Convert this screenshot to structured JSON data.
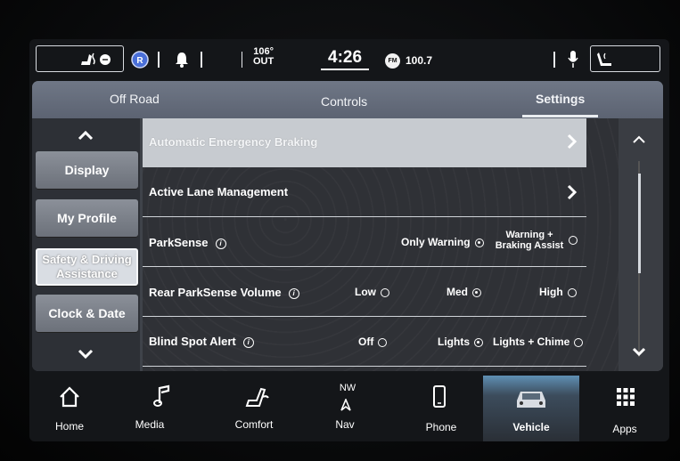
{
  "status_bar": {
    "temperature": "106°",
    "temperature_label": "OUT",
    "time": "4:26",
    "radio_band": "FM",
    "radio_station": "100.7"
  },
  "tabs": [
    {
      "label": "Off Road",
      "active": false
    },
    {
      "label": "Controls",
      "active": false
    },
    {
      "label": "Settings",
      "active": true
    }
  ],
  "sidebar": {
    "items": [
      {
        "label": "Display",
        "selected": false
      },
      {
        "label": "My Profile",
        "selected": false
      },
      {
        "label": "Safety & Driving Assistance",
        "selected": true
      },
      {
        "label": "Clock & Date",
        "selected": false
      }
    ]
  },
  "settings": {
    "automatic_emergency_braking": "Automatic Emergency Braking",
    "active_lane_management": "Active Lane Management",
    "parksense": {
      "label": "ParkSense",
      "options": [
        "Only Warning",
        "Warning + Braking Assist"
      ],
      "selected": "Only Warning"
    },
    "rear_parksense_volume": {
      "label": "Rear ParkSense Volume",
      "options": [
        "Low",
        "Med",
        "High"
      ],
      "selected": "Med"
    },
    "blind_spot_alert": {
      "label": "Blind Spot Alert",
      "options": [
        "Off",
        "Lights",
        "Lights + Chime"
      ],
      "selected": "Lights"
    }
  },
  "bottom_nav": {
    "compass_heading": "NW",
    "items": [
      {
        "label": "Home",
        "icon": "home-icon"
      },
      {
        "label": "Media",
        "icon": "music-note-icon"
      },
      {
        "label": "Comfort",
        "icon": "seat-icon"
      },
      {
        "label": "Nav",
        "icon": "compass-arrow-icon"
      },
      {
        "label": "Phone",
        "icon": "phone-icon"
      },
      {
        "label": "Vehicle",
        "icon": "car-icon",
        "active": true
      },
      {
        "label": "Apps",
        "icon": "apps-grid-icon"
      }
    ]
  }
}
